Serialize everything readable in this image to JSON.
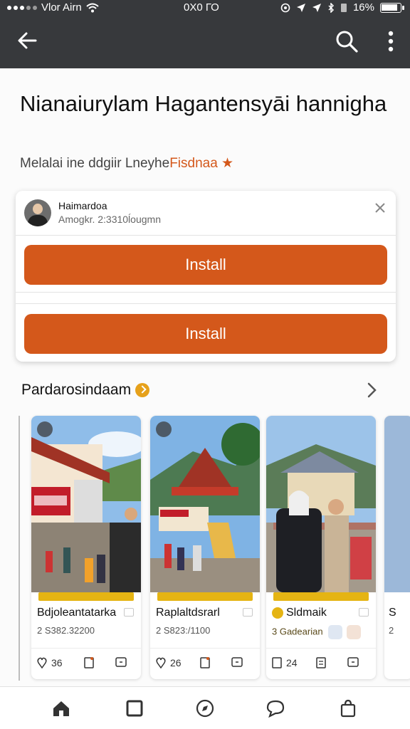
{
  "status_bar": {
    "carrier": "Vlor Airn",
    "time": "0X0 ГО",
    "battery": "16%"
  },
  "app_bar": {
    "back_icon": "arrow-left-icon",
    "search_icon": "search-icon",
    "menu_icon": "more-vertical-icon"
  },
  "page": {
    "title": "Nianaiurylam Hagantensyāi hannigha",
    "subtitle_main": "Melalai ine ddgiir Lneyhe",
    "subtitle_accent": "Fisdnaa ★"
  },
  "card": {
    "name": "Haimardoa",
    "meta": "Amogkr. 2:3310ĺougmn",
    "install_1": "Install",
    "install_2": "Install",
    "accent": "#d4581b"
  },
  "section": {
    "title": "Pardarosindaam"
  },
  "tiles": [
    {
      "name": "Bdjoleantatarka",
      "value": "2 S382.32200",
      "count": "36"
    },
    {
      "name": "Raplaltdsrarl",
      "value": "2 S823:/1100",
      "count": "26"
    },
    {
      "name": "Sldmaik",
      "value": "3 Gadearian",
      "count": "24"
    }
  ],
  "partial_tile": {
    "name": "S",
    "value": "2"
  },
  "bottom_nav": [
    "home-icon",
    "bookmark-icon",
    "explore-icon",
    "chat-icon",
    "bag-icon"
  ]
}
